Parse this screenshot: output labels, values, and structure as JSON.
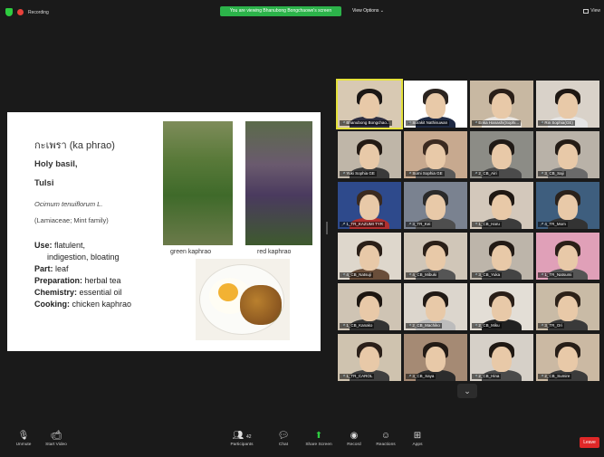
{
  "topbar": {
    "recording": "Recording",
    "viewing_banner": "You are viewing Bhanubong Bongchaowe's screen",
    "view_options": "View Options ⌄",
    "view": "View"
  },
  "slide": {
    "thai_name": "กะเพรา (ka phrao)",
    "name1": "Holy basil,",
    "name2": "Tulsi",
    "latin": "Ocimum tenuiflorum L.",
    "family": "(Lamiaceae; Mint family)",
    "use_label": "Use:",
    "use_value": " flatulent,",
    "use_value2": "indigestion, bloating",
    "part_label": "Part:",
    "part_value": " leaf",
    "prep_label": "Preparation:",
    "prep_value": " herbal tea",
    "chem_label": "Chemistry:",
    "chem_value": " essential oil",
    "cook_label": "Cooking:",
    "cook_value": " chicken kaphrao",
    "cap_green": "green kaphrao",
    "cap_red": "red kaphrao"
  },
  "participants": [
    {
      "name": "Bhanubong Bongchao...",
      "bg": "#d8c9b3",
      "hair": "#1b1715",
      "shirt": "#2d2d40"
    },
    {
      "name": "Surakit Nathisuwan",
      "bg": "#ffffff",
      "hair": "#2b2420",
      "shirt": "#1f2a44"
    },
    {
      "name": "Erika Hanashi(Sophi...",
      "bg": "#c8b8a2",
      "hair": "#2a1f18",
      "shirt": "#e9e5e0"
    },
    {
      "name": "Rin Sophia(GE)",
      "bg": "#d9d2c9",
      "hair": "#1e1713",
      "shirt": "#e5e5e5"
    },
    {
      "name": "Yuki Sophia GE",
      "bg": "#bfb6a8",
      "hair": "#231a14",
      "shirt": "#3a3a3a"
    },
    {
      "name": "Sumi Sophia GE",
      "bg": "#c7a98f",
      "hair": "#3b2a20",
      "shirt": "#595959"
    },
    {
      "name": "2_CB_Airi",
      "bg": "#8c8c86",
      "hair": "#201a16",
      "shirt": "#4b4b4b"
    },
    {
      "name": "3_CB_Saji",
      "bg": "#b9b2a8",
      "hair": "#241c16",
      "shirt": "#6a6a6a"
    },
    {
      "name": "1_TR_KAZUMI TYR",
      "bg": "#2e4a8c",
      "hair": "#3a2a20",
      "shirt": "#b03030"
    },
    {
      "name": "3_TR_Kei",
      "bg": "#7a8290",
      "hair": "#2a2a2a",
      "shirt": "#4e4e4e"
    },
    {
      "name": "1_CB_Haru",
      "bg": "#d3c8bb",
      "hair": "#1f1813",
      "shirt": "#3c3c3c"
    },
    {
      "name": "4_TR_Mom",
      "bg": "#3e5e7e",
      "hair": "#2a221c",
      "shirt": "#333333"
    },
    {
      "name": "4_CB_Natsuji",
      "bg": "#ded7cc",
      "hair": "#2a1f18",
      "shirt": "#6a4e3a"
    },
    {
      "name": "4_CB_Mibuki",
      "bg": "#d0c6b8",
      "hair": "#2a1f18",
      "shirt": "#555555"
    },
    {
      "name": "3_CB_Yuka",
      "bg": "#bdb5aa",
      "hair": "#221a15",
      "shirt": "#444444"
    },
    {
      "name": "1_TR_Natsumi",
      "bg": "#e0a0b8",
      "hair": "#2a1f18",
      "shirt": "#555555"
    },
    {
      "name": "1_CB_Kanako",
      "bg": "#cfc4b4",
      "hair": "#1d1611",
      "shirt": "#333333"
    },
    {
      "name": "2_CB_Machiko",
      "bg": "#dcd6cd",
      "hair": "#201915",
      "shirt": "#bcbcbc"
    },
    {
      "name": "2_CB_Miku",
      "bg": "#e3ded6",
      "hair": "#2a1f18",
      "shirt": "#222222"
    },
    {
      "name": "3_TR_Ori",
      "bg": "#c9bba6",
      "hair": "#2d2219",
      "shirt": "#3a3a3a"
    },
    {
      "name": "1_TR_CAROL",
      "bg": "#cfc3af",
      "hair": "#2b2019",
      "shirt": "#3f3f3f"
    },
    {
      "name": "3_CB_Saya",
      "bg": "#a58a74",
      "hair": "#221a15",
      "shirt": "#2c2c2c"
    },
    {
      "name": "2_CB_Hina",
      "bg": "#d6d0c8",
      "hair": "#1f1813",
      "shirt": "#4a4a4a"
    },
    {
      "name": "2_CB_Sumire",
      "bg": "#cbb9a3",
      "hair": "#271e18",
      "shirt": "#3b3b3b"
    }
  ],
  "toolbar": {
    "unmute": "Unmute",
    "start_video": "Start Video",
    "participants": "Participants",
    "participants_count": "42",
    "chat": "Chat",
    "share_screen": "Share Screen",
    "record": "Record",
    "reactions": "Reactions",
    "apps": "Apps",
    "leave": "Leave"
  },
  "colors": {
    "banner_green": "#2cb34a",
    "leave_red": "#e02828",
    "active_speaker": "#e5e23a"
  }
}
